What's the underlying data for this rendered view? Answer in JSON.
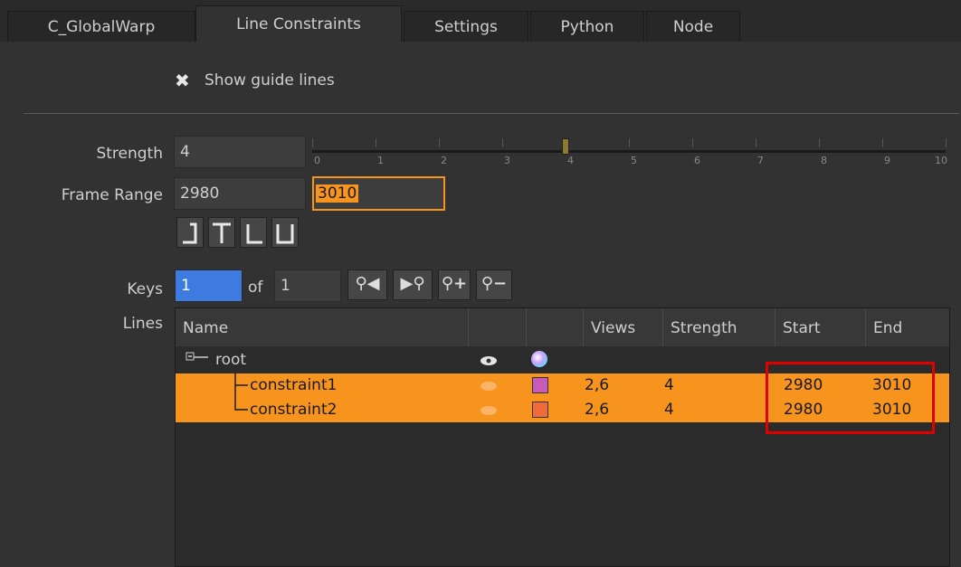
{
  "tabs": [
    {
      "label": "C_GlobalWarp"
    },
    {
      "label": "Line Constraints"
    },
    {
      "label": "Settings"
    },
    {
      "label": "Python"
    },
    {
      "label": "Node"
    }
  ],
  "show_guide_lines": {
    "label": "Show guide lines",
    "checked": true,
    "check_glyph": "✖"
  },
  "strength": {
    "label": "Strength",
    "value": "4",
    "slider_value": 4,
    "slider_min": 0,
    "slider_max": 10,
    "ticks": [
      "0",
      "1",
      "2",
      "3",
      "4",
      "5",
      "6",
      "7",
      "8",
      "9",
      "10"
    ]
  },
  "frame_range": {
    "label": "Frame Range",
    "start": "2980",
    "end": "3010"
  },
  "keys": {
    "label": "Keys",
    "current": "1",
    "of_label": "of",
    "total": "1"
  },
  "lines": {
    "label": "Lines",
    "columns": [
      "Name",
      "",
      "",
      "Views",
      "Strength",
      "Start",
      "End"
    ],
    "root": {
      "name": "root"
    },
    "rows": [
      {
        "name": "constraint1",
        "views": "2,6",
        "strength": "4",
        "start": "2980",
        "end": "3010",
        "color": "#c85ab8"
      },
      {
        "name": "constraint2",
        "views": "2,6",
        "strength": "4",
        "start": "2980",
        "end": "3010",
        "color": "#f06a3a"
      }
    ]
  },
  "colors": {
    "accent": "#f7941e",
    "highlight": "#e00000",
    "key_field": "#3d7be0"
  }
}
